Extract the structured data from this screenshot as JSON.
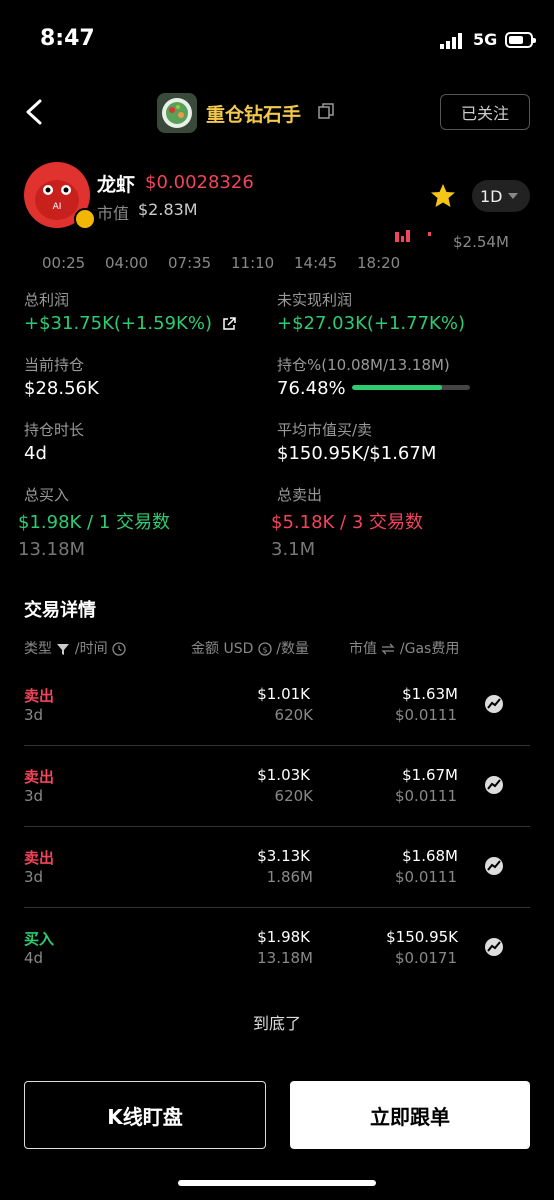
{
  "status_bar": {
    "time": "8:47",
    "network": "5G"
  },
  "header": {
    "title": "重仓钻石手",
    "follow_label": "已关注"
  },
  "token": {
    "name": "龙虾",
    "price": "$0.0028326",
    "mcap_label": "市值",
    "mcap_value": "$2.83M",
    "avatar_text": "AI",
    "period": "1D"
  },
  "mini_chart": {
    "max_label": "$2.54M",
    "ticks": [
      "00:25",
      "04:00",
      "07:35",
      "11:10",
      "14:45",
      "18:20"
    ]
  },
  "stats": {
    "total_profit_label": "总利润",
    "total_profit_value": "+$31.75K(+1.59K%)",
    "unrealized_label": "未实现利润",
    "unrealized_value": "+$27.03K(+1.77K%)",
    "holding_label": "当前持仓",
    "holding_value": "$28.56K",
    "holding_pct_label": "持仓%(10.08M/13.18M)",
    "holding_pct_value": "76.48%",
    "holding_pct_fraction": 0.7648,
    "duration_label": "持仓时长",
    "duration_value": "4d",
    "avg_mcap_label": "平均市值买/卖",
    "avg_mcap_value": "$150.95K/$1.67M",
    "total_buy_label": "总买入",
    "total_buy_value": "$1.98K / 1 交易数",
    "total_buy_qty": "13.18M",
    "total_sell_label": "总卖出",
    "total_sell_value": "$5.18K / 3 交易数",
    "total_sell_qty": "3.1M"
  },
  "trades": {
    "title": "交易详情",
    "headers": {
      "type": "类型",
      "time": "/时间",
      "amount": "金额 USD",
      "qty": "/数量",
      "mcap": "市值",
      "gas": "/Gas费用"
    },
    "rows": [
      {
        "type": "卖出",
        "side": "sell",
        "age": "3d",
        "amount": "$1.01K",
        "qty": "620K",
        "mcap": "$1.63M",
        "gas": "$0.0111"
      },
      {
        "type": "卖出",
        "side": "sell",
        "age": "3d",
        "amount": "$1.03K",
        "qty": "620K",
        "mcap": "$1.67M",
        "gas": "$0.0111"
      },
      {
        "type": "卖出",
        "side": "sell",
        "age": "3d",
        "amount": "$3.13K",
        "qty": "1.86M",
        "mcap": "$1.68M",
        "gas": "$0.0111"
      },
      {
        "type": "买入",
        "side": "buy",
        "age": "4d",
        "amount": "$1.98K",
        "qty": "13.18M",
        "mcap": "$150.95K",
        "gas": "$0.0171"
      }
    ],
    "end_text": "到底了"
  },
  "actions": {
    "kline_label": "K线盯盘",
    "follow_label": "立即跟单"
  },
  "colors": {
    "green": "#2ecc71",
    "red": "#f0455a",
    "gold": "#f2c94c"
  }
}
